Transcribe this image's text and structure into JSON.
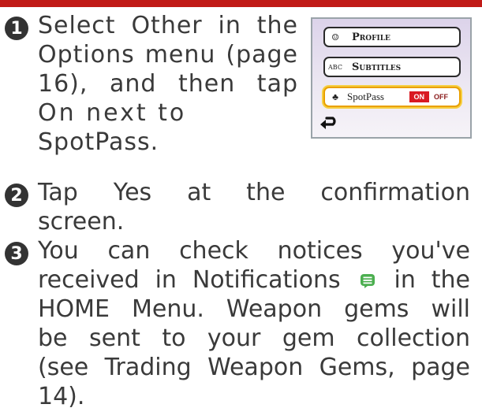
{
  "steps": [
    {
      "number": "1",
      "lines": [
        "Select Other in the",
        "Options menu (page",
        "16), and then tap",
        "On next to",
        "SpotPass."
      ]
    },
    {
      "number": "2",
      "lines": [
        "Tap Yes at the confirmation",
        "screen."
      ]
    },
    {
      "number": "3",
      "line1": "You can check notices you've",
      "line2_before": "received in Notifications",
      "line2_after": "in the",
      "lines_rest": [
        "HOME Menu. Weapon gems will",
        "be sent to your gem collection",
        "(see Trading Weapon Gems, page",
        "14)."
      ]
    }
  ],
  "options_menu": {
    "items": [
      {
        "icon_text": "☺",
        "label": "Profile"
      },
      {
        "icon_text": "ABC",
        "label": "Subtitles"
      },
      {
        "icon_text": "♣",
        "label": "SpotPass",
        "toggle": {
          "on": "ON",
          "off": "OFF"
        }
      }
    ]
  },
  "icons": {
    "notifications": "notifications-icon",
    "back": "back-arrow-icon"
  },
  "colors": {
    "header_bar": "#c11b17",
    "step_circle": "#333333",
    "toggle_on": "#d91a22",
    "notifications_icon": "#4caf50"
  }
}
